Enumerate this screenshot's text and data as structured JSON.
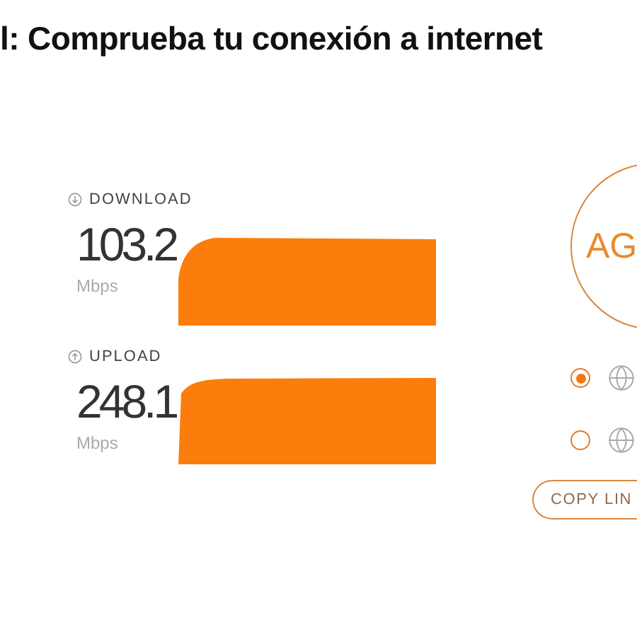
{
  "heading": "l: Comprueba tu conexión a internet",
  "results": [
    {
      "kind": "download",
      "label": "DOWNLOAD",
      "value": "103.2",
      "unit": "Mbps"
    },
    {
      "kind": "upload",
      "label": "UPLOAD",
      "value": "248.1",
      "unit": "Mbps"
    }
  ],
  "go_button": {
    "label": "AG"
  },
  "servers": [
    {
      "selected": true
    },
    {
      "selected": false
    }
  ],
  "copy_button": {
    "label": "COPY LIN"
  }
}
